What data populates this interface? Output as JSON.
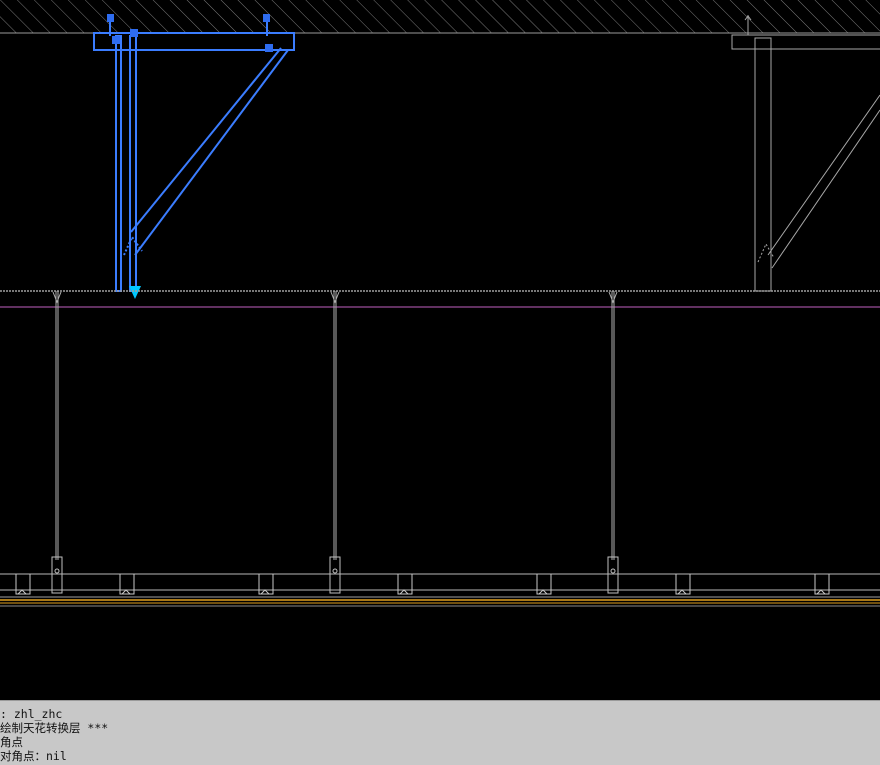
{
  "app": {
    "colors": {
      "background": "#000000",
      "selection": "#3b7dff",
      "selection_grip": "#2e6cf0",
      "geometry": "#b8b8b8",
      "hatch": "#8a8a8a",
      "finish_layer": "#e0a020",
      "magenta_line": "#c060c0",
      "arrow": "#00c8ff",
      "command_bg": "#c8c8c8"
    }
  },
  "command_line": {
    "lines": [
      ": zhl_zhc",
      "绘制天花转换层 ***",
      "角点",
      "对角点：nil"
    ]
  }
}
